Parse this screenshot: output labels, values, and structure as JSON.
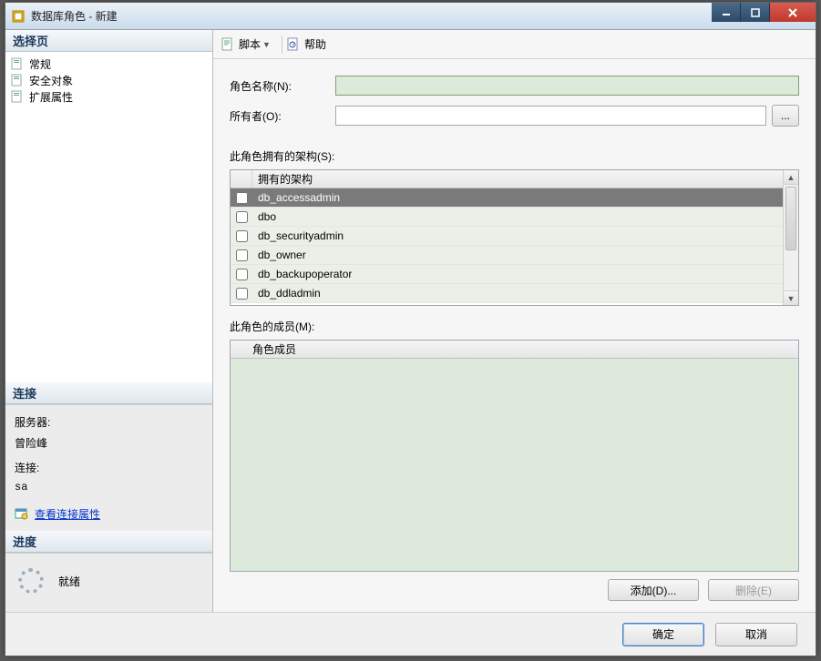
{
  "window_title": "数据库角色 - 新建",
  "left_panel": {
    "select_page": "选择页",
    "nav": [
      "常规",
      "安全对象",
      "扩展属性"
    ],
    "connection_header": "连接",
    "server_label": "服务器:",
    "server_value": "曾险峰",
    "conn_label": "连接:",
    "conn_value": "sa",
    "view_props": "查看连接属性",
    "progress_header": "进度",
    "ready": "就绪"
  },
  "toolbar": {
    "script": "脚本",
    "help": "帮助"
  },
  "form": {
    "role_name_label": "角色名称(N):",
    "owner_label": "所有者(O):",
    "ellipsis": "..."
  },
  "schemas": {
    "label": "此角色拥有的架构(S):",
    "column": "拥有的架构",
    "rows": [
      "db_accessadmin",
      "dbo",
      "db_securityadmin",
      "db_owner",
      "db_backupoperator",
      "db_ddladmin"
    ]
  },
  "members": {
    "label": "此角色的成员(M):",
    "column": "角色成员",
    "add": "添加(D)...",
    "remove": "删除(E)"
  },
  "footer": {
    "ok": "确定",
    "cancel": "取消"
  }
}
